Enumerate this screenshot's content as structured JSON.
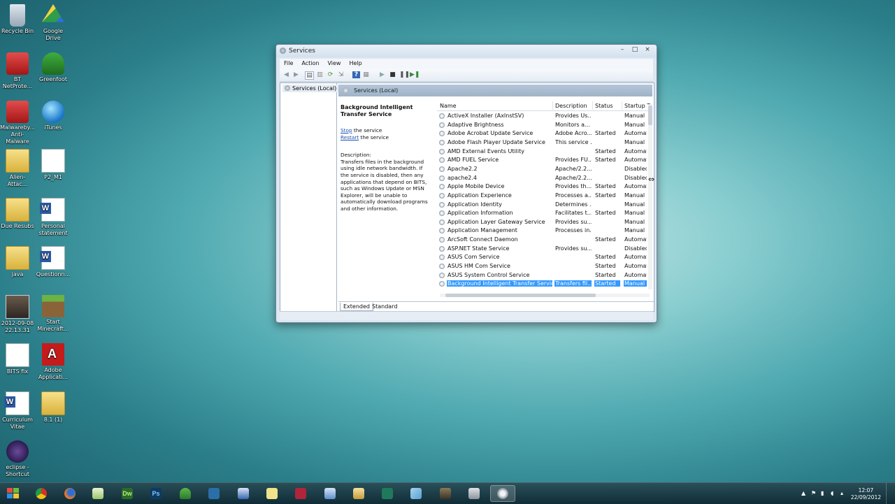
{
  "desktop": {
    "icons": [
      {
        "label": "Recycle Bin"
      },
      {
        "label": "Google Drive"
      },
      {
        "label": "BT\nNetProte..."
      },
      {
        "label": "Greenfoot"
      },
      {
        "label": "Malwareby...\nAnti-Malware"
      },
      {
        "label": "iTunes"
      },
      {
        "label": "Alien-Attac..."
      },
      {
        "label": "P2_M1"
      },
      {
        "label": "Due Resubs"
      },
      {
        "label": "Personal\nstatement"
      },
      {
        "label": "java"
      },
      {
        "label": "Questionn..."
      },
      {
        "label": "2012-09-08\n22.13.31"
      },
      {
        "label": "Start\nMinecraft..."
      },
      {
        "label": "BITS fix"
      },
      {
        "label": "Adobe\nApplicati..."
      },
      {
        "label": "Curriculum\nVitae"
      },
      {
        "label": "8.1 (1)"
      },
      {
        "label": "eclipse -\nShortcut"
      }
    ]
  },
  "window": {
    "title": "Services",
    "controls": {
      "minimize": "–",
      "maximize": "□",
      "close": "×"
    },
    "menu": [
      "File",
      "Action",
      "View",
      "Help"
    ],
    "tree": {
      "item": "Services (Local)"
    },
    "pane_header": "Services (Local)",
    "details": {
      "service_name": "Background Intelligent Transfer Service",
      "stop_link": "Stop",
      "stop_suffix": " the service",
      "restart_link": "Restart",
      "restart_suffix": " the service",
      "description_label": "Description:",
      "description": "Transfers files in the background using idle network bandwidth. If the service is disabled, then any applications that depend on BITS, such as Windows Update or MSN Explorer, will be unable to automatically download programs and other information."
    },
    "columns": {
      "name": "Name",
      "description": "Description",
      "status": "Status",
      "startup": "Startup T"
    },
    "services": [
      {
        "name": "ActiveX Installer (AxInstSV)",
        "description": "Provides Us...",
        "status": "",
        "startup": "Manual"
      },
      {
        "name": "Adaptive Brightness",
        "description": "Monitors a...",
        "status": "",
        "startup": "Manual"
      },
      {
        "name": "Adobe Acrobat Update Service",
        "description": "Adobe Acro...",
        "status": "Started",
        "startup": "Automat"
      },
      {
        "name": "Adobe Flash Player Update Service",
        "description": "This service ...",
        "status": "",
        "startup": "Manual"
      },
      {
        "name": "AMD External Events Utility",
        "description": "",
        "status": "Started",
        "startup": "Automat"
      },
      {
        "name": "AMD FUEL Service",
        "description": "Provides FU...",
        "status": "Started",
        "startup": "Automat"
      },
      {
        "name": "Apache2.2",
        "description": "Apache/2.2....",
        "status": "",
        "startup": "Disabled"
      },
      {
        "name": "apache2.4",
        "description": "Apache/2.2....",
        "status": "",
        "startup": "Disabled"
      },
      {
        "name": "Apple Mobile Device",
        "description": "Provides th...",
        "status": "Started",
        "startup": "Automat"
      },
      {
        "name": "Application Experience",
        "description": "Processes a...",
        "status": "Started",
        "startup": "Manual"
      },
      {
        "name": "Application Identity",
        "description": "Determines ...",
        "status": "",
        "startup": "Manual"
      },
      {
        "name": "Application Information",
        "description": "Facilitates t...",
        "status": "Started",
        "startup": "Manual"
      },
      {
        "name": "Application Layer Gateway Service",
        "description": "Provides su...",
        "status": "",
        "startup": "Manual"
      },
      {
        "name": "Application Management",
        "description": "Processes in...",
        "status": "",
        "startup": "Manual"
      },
      {
        "name": "ArcSoft Connect Daemon",
        "description": "",
        "status": "Started",
        "startup": "Automat"
      },
      {
        "name": "ASP.NET State Service",
        "description": "Provides su...",
        "status": "",
        "startup": "Disabled"
      },
      {
        "name": "ASUS Com Service",
        "description": "",
        "status": "Started",
        "startup": "Automat"
      },
      {
        "name": "ASUS HM Com Service",
        "description": "",
        "status": "Started",
        "startup": "Automat"
      },
      {
        "name": "ASUS System Control Service",
        "description": "",
        "status": "Started",
        "startup": "Automat"
      },
      {
        "name": "Background Intelligent Transfer Service",
        "description": "Transfers fil...",
        "status": "Started",
        "startup": "Manual",
        "selected": true
      }
    ],
    "tabs": [
      "Extended",
      "Standard"
    ]
  },
  "taskbar": {
    "clock_time": "12:07",
    "clock_date": "22/09/2012",
    "apps": [
      "Google Chrome",
      "Firefox",
      "Notepad++",
      "Dreamweaver",
      "Photoshop",
      "Greenfoot",
      "Aptana",
      "Outlook",
      "Sticky Notes",
      "Access",
      "Task Manager",
      "Explorer",
      "Publisher",
      "Paint",
      "Unknown",
      "Tools",
      "Services"
    ],
    "dw_label": "Dw",
    "ps_label": "Ps"
  }
}
